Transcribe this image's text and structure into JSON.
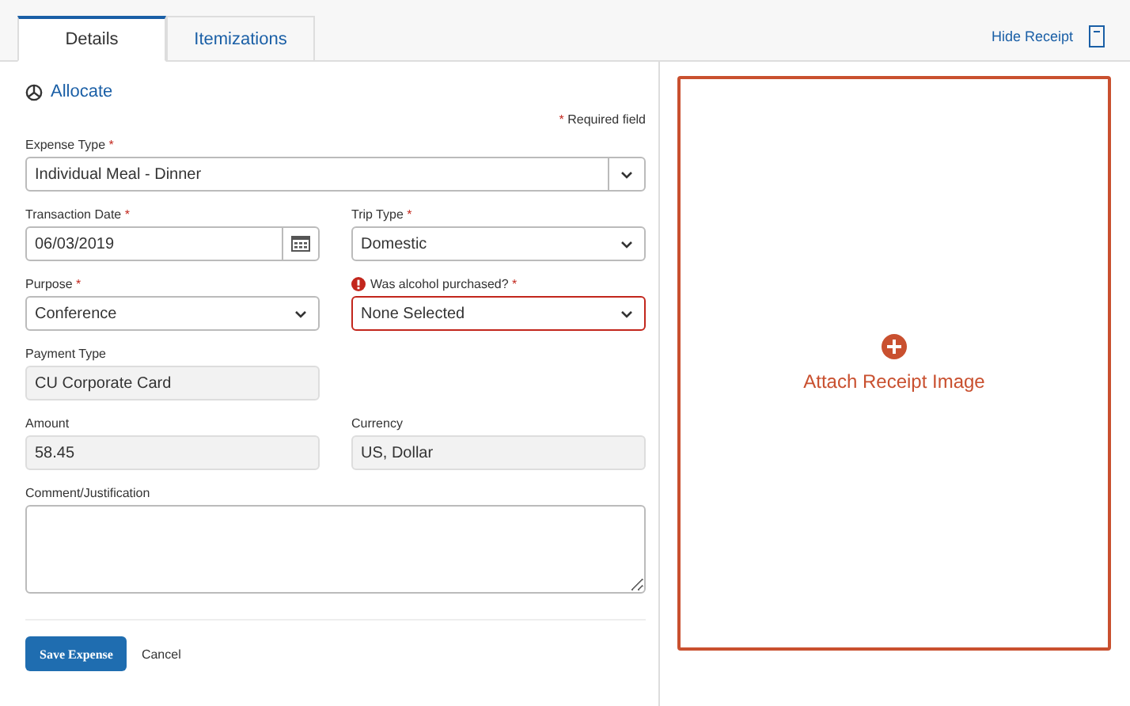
{
  "tabs": [
    {
      "label": "Details",
      "selected": true
    },
    {
      "label": "Itemizations",
      "selected": false
    }
  ],
  "hide_receipt": "Hide Receipt",
  "allocate": "Allocate",
  "required_note": {
    "mark": "*",
    "text": "Required field"
  },
  "rows": [
    [
      {
        "label": "Expense Type",
        "required": true,
        "kind": "select",
        "value": "Individual Meal - Dinner",
        "wide": true,
        "error": false
      }
    ],
    [
      {
        "label": "Transaction Date",
        "required": true,
        "kind": "date",
        "value": "06/03/2019",
        "wide": false,
        "error": false
      },
      {
        "label": "Trip Type",
        "required": true,
        "kind": "select",
        "value": "Domestic",
        "wide": false,
        "error": false
      }
    ],
    [
      {
        "label": "Purpose",
        "required": true,
        "kind": "select",
        "value": "Conference",
        "wide": false,
        "error": false
      },
      {
        "label": "Was alcohol purchased?",
        "required": true,
        "kind": "select",
        "value": "None Selected",
        "wide": false,
        "error": true
      }
    ],
    [
      {
        "label": "Payment Type",
        "required": false,
        "kind": "readonly",
        "value": "CU Corporate Card",
        "wide": false,
        "error": false
      }
    ],
    [
      {
        "label": "Amount",
        "required": false,
        "kind": "readonly",
        "value": "58.45",
        "wide": false,
        "error": false
      },
      {
        "label": "Currency",
        "required": false,
        "kind": "readonly",
        "value": "US, Dollar",
        "wide": false,
        "error": false
      }
    ],
    [
      {
        "label": "Comment/Justification",
        "required": false,
        "kind": "textarea",
        "wide": true,
        "error": false
      }
    ]
  ],
  "buttons": {
    "save": "Save Expense",
    "cancel": "Cancel"
  },
  "receipt": {
    "label": "Attach Receipt Image"
  }
}
